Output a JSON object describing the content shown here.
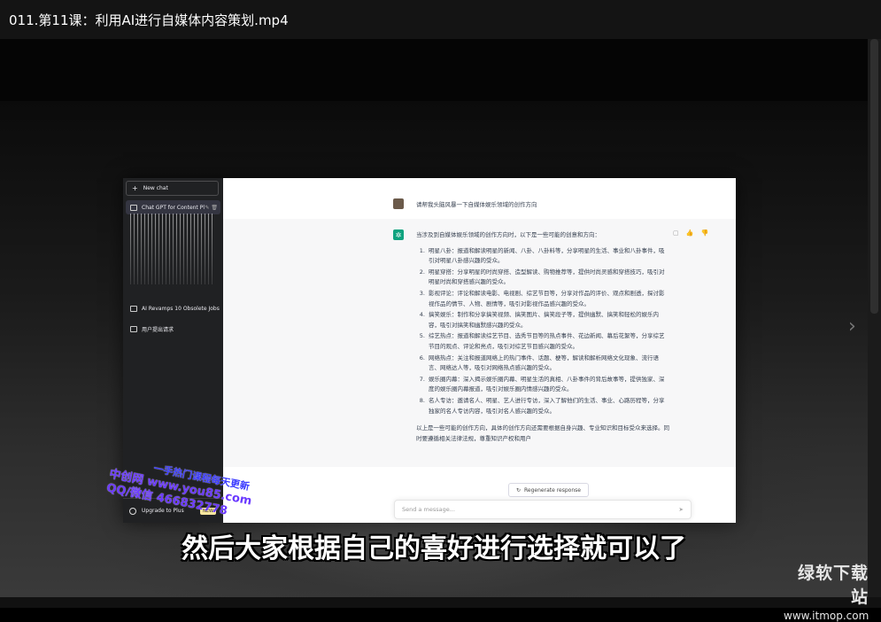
{
  "titlebar": {
    "title": "011.第11课：利用AI进行自媒体内容策划.mp4"
  },
  "sidebar": {
    "new_chat": "New chat",
    "conversations": [
      {
        "label": "Chat GPT for Content Pl"
      },
      {
        "label": "AI Revamps 10 Obsolete Jobs"
      },
      {
        "label": "用户提出请求"
      }
    ],
    "upgrade_label": "Upgrade to Plus",
    "new_badge": "NEW"
  },
  "chat": {
    "user_message": "请帮我头脑风暴一下自媒体娱乐领域的创作方向",
    "answer_intro": "当涉及到自媒体娱乐领域的创作方向时，以下是一些可能的创意和方向：",
    "answer_items": [
      "明星八卦：报道和解读明星的新闻、八卦、八卦料等，分享明星的生活、事业和八卦事件，吸引对明星八卦感兴趣的受众。",
      "明星穿搭：分享明星的时尚穿搭、造型解读、购物推荐等，提供时尚灵感和穿搭技巧，吸引对明星时尚和穿搭感兴趣的受众。",
      "影视评论：评论和解读电影、电视剧、综艺节目等，分享对作品的评价、观点和剧透，探讨影视作品的情节、人物、剧情等，吸引对影视作品感兴趣的受众。",
      "搞笑娱乐：制作和分享搞笑视频、搞笑图片、搞笑段子等，提供幽默、搞笑和轻松的娱乐内容，吸引对搞笑和幽默感兴趣的受众。",
      "综艺热点：报道和解读综艺节目、选秀节目等的热点事件、花边新闻、幕后花絮等，分享综艺节目的观点、评论和亮点，吸引对综艺节目感兴趣的受众。",
      "网络热点：关注和报道网络上的热门事件、话题、梗等，解读和解析网络文化现象、流行语言、网络达人等，吸引对网络热点感兴趣的受众。",
      "娱乐圈内幕：深入揭示娱乐圈内幕、明星生活的真相、八卦事件的背后故事等，提供独家、深度的娱乐圈内幕报道，吸引对娱乐圈内情感兴趣的受众。",
      "名人专访：邀请名人、明星、艺人进行专访，深入了解他们的生活、事业、心路历程等，分享独家的名人专访内容，吸引对名人感兴趣的受众。"
    ],
    "answer_conclusion": "以上是一些可能的创作方向，具体的创作方向还需要根据自身兴趣、专业知识和目标受众来选择。同时要遵循相关法律法规，尊重知识产权和用户",
    "regenerate_label": "Regenerate response",
    "input_placeholder": "Send a message..."
  },
  "watermark": {
    "line1": "中创网 www.you85.com",
    "line2": "QQ/微信 466832778",
    "overlay": "一手热门课程每天更新"
  },
  "subtitle": "然后大家根据自己的喜好进行选择就可以了",
  "site_logo": {
    "name": "绿软下载站",
    "url": "www.itmop.com"
  }
}
